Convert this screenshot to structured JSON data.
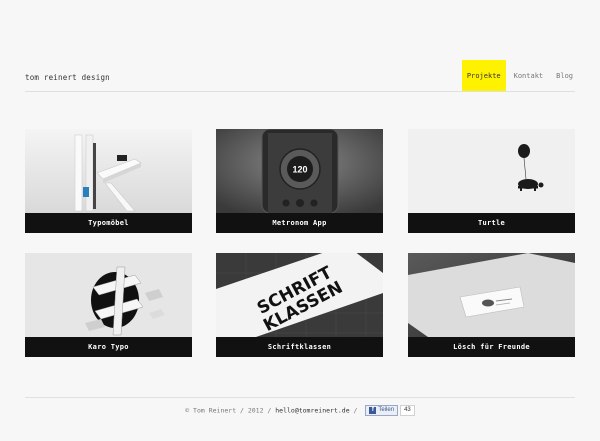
{
  "header": {
    "brand": "tom reinert design",
    "nav": [
      {
        "label": "Projekte",
        "active": true
      },
      {
        "label": "Kontakt",
        "active": false
      },
      {
        "label": "Blog",
        "active": false
      }
    ],
    "accent_color": "#fff200"
  },
  "projects": [
    {
      "title": "Typomöbel"
    },
    {
      "title": "Metronom App",
      "display_value": "120"
    },
    {
      "title": "Turtle"
    },
    {
      "title": "Karo Typo"
    },
    {
      "title": "Schriftklassen",
      "artwork_text": [
        "SCHRIFT",
        "KLASSEN"
      ]
    },
    {
      "title": "Lösch für Freunde"
    }
  ],
  "footer": {
    "copyright": "© Tom Reinert / 2012 /",
    "email": "hello@tomreinert.de",
    "separator": "/",
    "share_label": "Teilen",
    "share_count": "43"
  }
}
